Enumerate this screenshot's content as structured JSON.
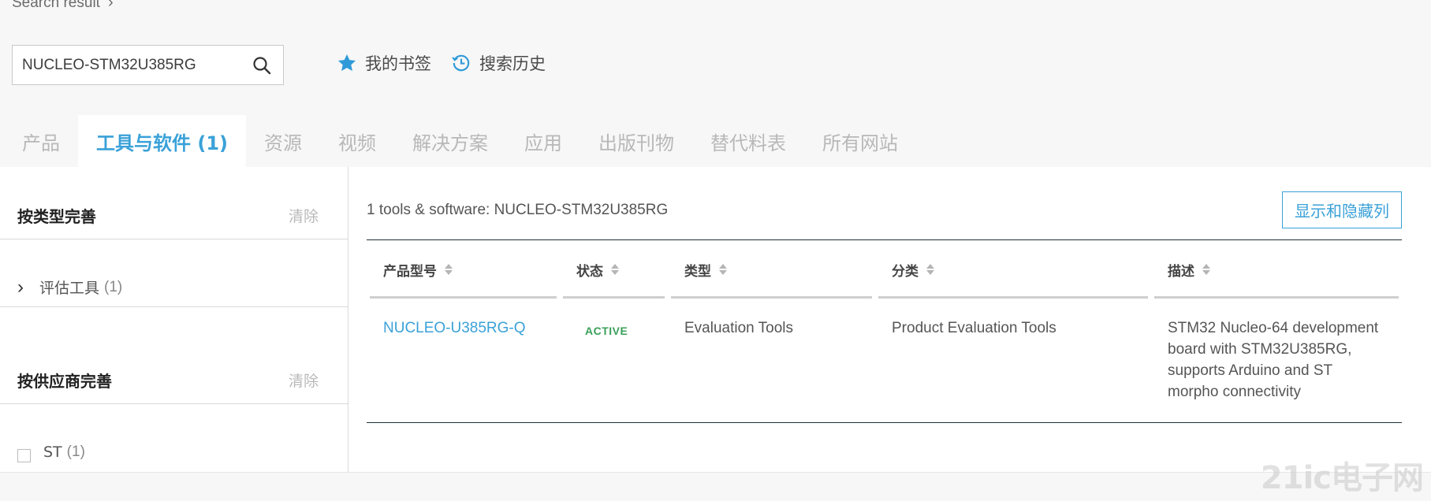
{
  "breadcrumb": {
    "label": "Search result"
  },
  "search": {
    "value": "NUCLEO-STM32U385RG"
  },
  "quick_links": [
    {
      "label": "我的书签",
      "icon": "star-icon"
    },
    {
      "label": "搜索历史",
      "icon": "history-icon"
    }
  ],
  "tabs": [
    {
      "label": "产品",
      "active": false
    },
    {
      "label": "工具与软件 (1)",
      "active": true
    },
    {
      "label": "资源",
      "active": false
    },
    {
      "label": "视频",
      "active": false
    },
    {
      "label": "解决方案",
      "active": false
    },
    {
      "label": "应用",
      "active": false
    },
    {
      "label": "出版刊物",
      "active": false
    },
    {
      "label": "替代料表",
      "active": false
    },
    {
      "label": "所有网站",
      "active": false
    }
  ],
  "sidebar": {
    "type_facet": {
      "title": "按类型完善",
      "clear": "清除",
      "item": {
        "label": "评估工具",
        "count": "(1)"
      }
    },
    "vendor_facet": {
      "title": "按供应商完善",
      "clear": "清除",
      "item": {
        "label": "ST",
        "count": "(1)"
      }
    }
  },
  "results": {
    "count_text": "1 tools & software: NUCLEO-STM32U385RG",
    "toggle_columns": "显示和隐藏列",
    "columns": [
      "产品型号",
      "状态",
      "类型",
      "分类",
      "描述"
    ],
    "rows": [
      {
        "part": "NUCLEO-U385RG-Q",
        "status": "ACTIVE",
        "type": "Evaluation Tools",
        "category": "Product Evaluation Tools",
        "description": "STM32 Nucleo-64 development board with STM32U385RG, supports Arduino and ST morpho connectivity"
      }
    ]
  },
  "watermark": "21ic电子网",
  "colors": {
    "accent": "#3aa1d8",
    "status_active": "#3aa05a",
    "tab_inactive": "#b8b8b8"
  }
}
